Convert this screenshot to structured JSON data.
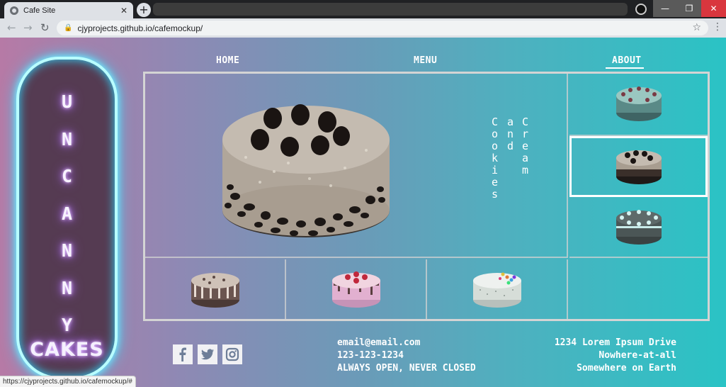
{
  "browser": {
    "tab_title": "Cafe Site",
    "tab_close": "✕",
    "new_tab": "+",
    "url": "cjyprojects.github.io/cafemockup/",
    "status_url": "https://cjyprojects.github.io/cafemockup/#",
    "window_min": "—",
    "window_max": "❐",
    "window_close": "✕"
  },
  "logo": {
    "letters": [
      "U",
      "N",
      "C",
      "A",
      "N",
      "N",
      "Y"
    ],
    "word": "CAKES",
    "neon_color": "#7ff4ff"
  },
  "nav": {
    "home": "HOME",
    "menu": "MENU",
    "about": "ABOUT",
    "active": "about"
  },
  "featured": {
    "name_col1": [
      "C",
      "o",
      "o",
      "k",
      "i",
      "e",
      "s"
    ],
    "name_col2": [
      "a",
      "n",
      "d"
    ],
    "name_col3": [
      "C",
      "r",
      "e",
      "a",
      "m"
    ]
  },
  "footer": {
    "email": "email@email.com",
    "phone": "123-123-1234",
    "hours": "ALWAYS OPEN, NEVER CLOSED",
    "address_line1": "1234 Lorem Ipsum Drive",
    "address_line2": "Nowhere-at-all",
    "address_line3": "Somewhere on Earth"
  },
  "icons": [
    "facebook-icon",
    "twitter-icon",
    "instagram-icon",
    "lock-icon",
    "star-icon",
    "back-icon",
    "forward-icon",
    "reload-icon"
  ],
  "colors": {
    "gradient_left": "#b67aa6",
    "gradient_right": "#2ac3c5",
    "sign_fill": "#553b52"
  }
}
